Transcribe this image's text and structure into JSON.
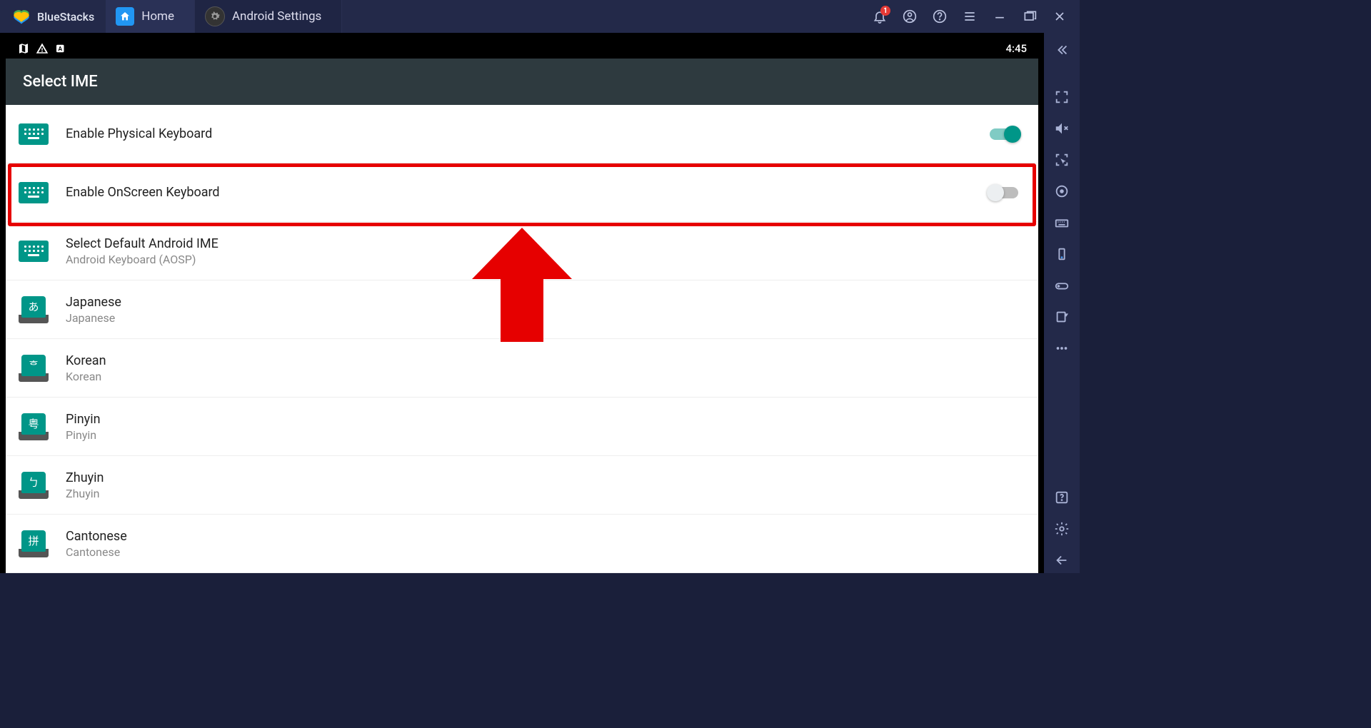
{
  "app": {
    "brand": "BlueStacks"
  },
  "tabs": {
    "home": "Home",
    "settings": "Android Settings"
  },
  "titlebar": {
    "notification_count": "1"
  },
  "statusbar": {
    "time": "4:45"
  },
  "page": {
    "title": "Select IME"
  },
  "settings": [
    {
      "title": "Enable Physical Keyboard",
      "sub": "",
      "icon": "kbd",
      "toggle": "on"
    },
    {
      "title": "Enable OnScreen Keyboard",
      "sub": "",
      "icon": "kbd",
      "toggle": "off"
    },
    {
      "title": "Select Default Android IME",
      "sub": "Android Keyboard (AOSP)",
      "icon": "kbd",
      "toggle": ""
    },
    {
      "title": "Japanese",
      "sub": "Japanese",
      "icon": "lang",
      "glyph": "あ",
      "toggle": ""
    },
    {
      "title": "Korean",
      "sub": "Korean",
      "icon": "lang",
      "glyph": "ᄒ",
      "toggle": ""
    },
    {
      "title": "Pinyin",
      "sub": "Pinyin",
      "icon": "lang",
      "glyph": "粤",
      "toggle": ""
    },
    {
      "title": "Zhuyin",
      "sub": "Zhuyin",
      "icon": "lang",
      "glyph": "ㄅ",
      "toggle": ""
    },
    {
      "title": "Cantonese",
      "sub": "Cantonese",
      "icon": "lang",
      "glyph": "拼",
      "toggle": ""
    }
  ]
}
